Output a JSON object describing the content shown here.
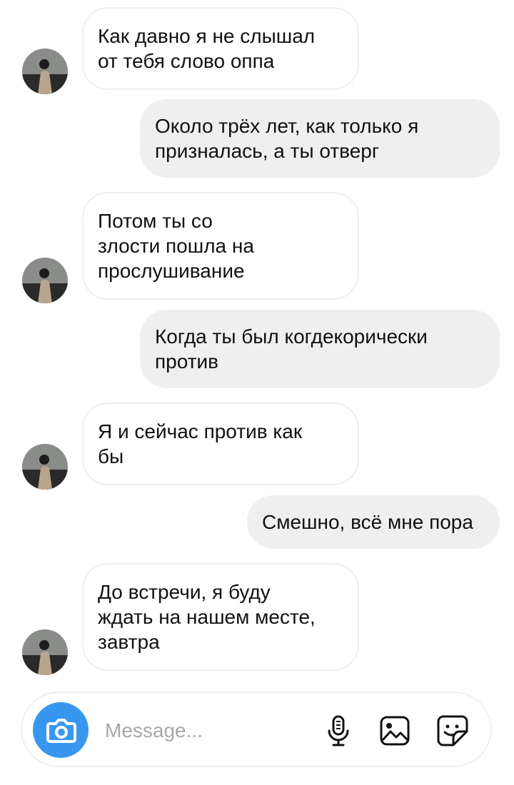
{
  "thread": {
    "messages": [
      {
        "sender": "them",
        "text": "Как давно я не слышал\nот тебя слово оппа"
      },
      {
        "sender": "me",
        "text": "Около трёх лет, как только я\nпризналась, а ты отверг"
      },
      {
        "sender": "them",
        "text": "Потом ты со\nзлости пошла на\nпрослушивание"
      },
      {
        "sender": "me",
        "text": "Когда ты был когдекорически\nпротив"
      },
      {
        "sender": "them",
        "text": "Я и сейчас против как\nбы"
      },
      {
        "sender": "me",
        "text": "Смешно, всё мне пора"
      },
      {
        "sender": "them",
        "text": "До встречи, я буду\nждать на нашем месте,\nзавтра"
      }
    ]
  },
  "composer": {
    "placeholder": "Message...",
    "icons": {
      "camera": "camera-icon",
      "microphone": "microphone-icon",
      "gallery": "gallery-icon",
      "sticker": "sticker-icon"
    }
  },
  "colors": {
    "incoming_bubble_border": "#efefef",
    "outgoing_bubble": "#efefef",
    "camera_button": "#3797f0",
    "placeholder": "#a8a8a8",
    "icon": "#111111"
  }
}
